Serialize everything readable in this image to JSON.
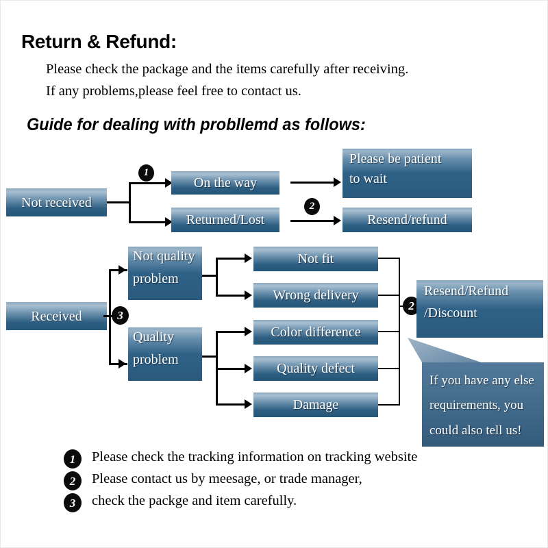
{
  "header": {
    "title": "Return & Refund:",
    "line1": "Please check the package and the items carefully after receiving.",
    "line2": "If any problems,please feel free to contact us.",
    "guide": "Guide for dealing with probllemd as follows:"
  },
  "flow_not_received": {
    "source": "Not received",
    "branch_badge_1": "1",
    "branch_badge_2": "2",
    "branches": [
      {
        "label": "On the way",
        "result": "Please be patient to wait",
        "result_line1": "Please be patient",
        "result_line2": "to wait"
      },
      {
        "label": "Returned/Lost",
        "result": "Resend/refund"
      }
    ]
  },
  "flow_received": {
    "source": "Received",
    "source_badge": "3",
    "converge_badge": "2",
    "categories": [
      {
        "label": "Not quality problem",
        "line1": "Not quality",
        "line2": "problem",
        "issues": [
          "Not fit",
          "Wrong delivery"
        ]
      },
      {
        "label": "Quality problem",
        "line1": "Quality",
        "line2": "problem",
        "issues": [
          "Color difference",
          "Quality defect",
          "Damage"
        ]
      }
    ],
    "issue_boxes": [
      "Not fit",
      "Wrong delivery",
      "Color difference",
      "Quality defect",
      "Damage"
    ],
    "outcome": {
      "line1": "Resend/Refund",
      "line2": "/Discount"
    },
    "callout": {
      "line1": "If you have any else",
      "line2": "requirements, you",
      "line3": "could also tell us!"
    }
  },
  "legend": [
    {
      "badge": "1",
      "text": "Please check the tracking information on tracking website"
    },
    {
      "badge": "2",
      "text": "Please contact us by meesage, or trade manager,"
    },
    {
      "badge": "3",
      "text": "check the packge and item carefully."
    }
  ],
  "colors": {
    "box_top": "#9ab4c8",
    "box_bottom": "#24567a",
    "badge_fill": "#0b0b0b",
    "text_on_box": "#ffffff",
    "page_background": "#ffffff",
    "connector": "#000000"
  }
}
